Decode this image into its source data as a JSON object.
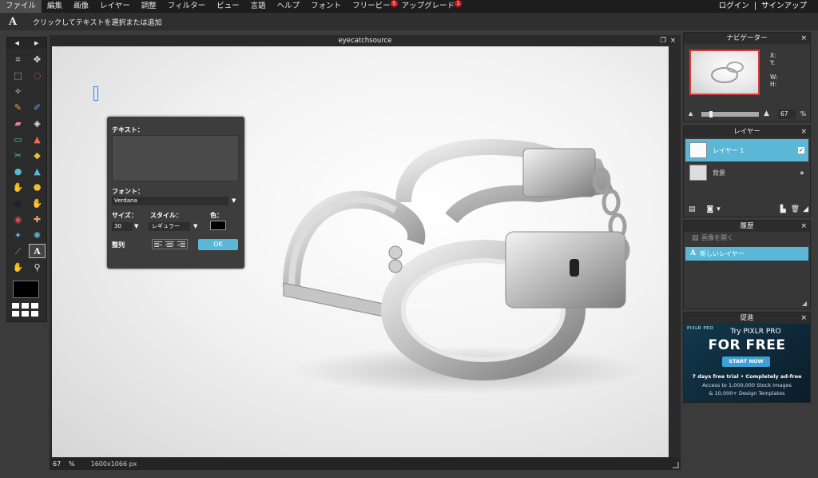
{
  "menu": {
    "items": [
      {
        "label": "ファイル"
      },
      {
        "label": "編集"
      },
      {
        "label": "画像"
      },
      {
        "label": "レイヤー"
      },
      {
        "label": "調整"
      },
      {
        "label": "フィルター"
      },
      {
        "label": "ビュー"
      },
      {
        "label": "言語"
      },
      {
        "label": "ヘルプ"
      },
      {
        "label": "フォント"
      },
      {
        "label": "フリービー",
        "badge": "5"
      },
      {
        "label": "アップグレード",
        "badge": "1"
      }
    ],
    "login": "ログイン",
    "separator": "|",
    "signup": "サインアップ"
  },
  "options_bar": {
    "tool_icon": "A",
    "hint": "クリックしてテキストを選択または追加"
  },
  "toolbox": {
    "nav_left": "◀",
    "nav_right": "▶",
    "tools": [
      {
        "name": "crop-tool-icon",
        "glyph": "⌗",
        "color": "#e8e8e8"
      },
      {
        "name": "move-tool-icon",
        "glyph": "✥",
        "color": "#e8e8e8"
      },
      {
        "name": "marquee-tool-icon",
        "glyph": "⬚",
        "color": "#e8e8e8"
      },
      {
        "name": "lasso-tool-icon",
        "glyph": "◌",
        "color": "#e85d5d"
      },
      {
        "name": "magic-wand-tool-icon",
        "glyph": "✧",
        "color": "#e8e8e8"
      },
      {
        "name": "blank-slot",
        "glyph": "",
        "color": "#e8e8e8"
      },
      {
        "name": "pencil-tool-icon",
        "glyph": "✎",
        "color": "#f0a030"
      },
      {
        "name": "brush-tool-icon",
        "glyph": "✐",
        "color": "#60a0f0"
      },
      {
        "name": "eraser-tool-icon",
        "glyph": "▰",
        "color": "#f07aa0"
      },
      {
        "name": "paint-bucket-tool-icon",
        "glyph": "◈",
        "color": "#e8e8e8"
      },
      {
        "name": "gradient-tool-icon",
        "glyph": "▭",
        "color": "#5ab8d6"
      },
      {
        "name": "clone-stamp-tool-icon",
        "glyph": "▲",
        "color": "#e07050"
      },
      {
        "name": "color-replace-tool-icon",
        "glyph": "✂",
        "color": "#5ab8d6"
      },
      {
        "name": "drawing-tool-icon",
        "glyph": "◆",
        "color": "#f0c030"
      },
      {
        "name": "blur-tool-icon",
        "glyph": "●",
        "color": "#5ab8d6"
      },
      {
        "name": "sharpen-tool-icon",
        "glyph": "▲",
        "color": "#5ab8d6"
      },
      {
        "name": "smudge-tool-icon",
        "glyph": "✋",
        "color": "#f0a030"
      },
      {
        "name": "sponge-tool-icon",
        "glyph": "⬣",
        "color": "#f0c030"
      },
      {
        "name": "dodge-tool-icon",
        "glyph": "●",
        "color": "#222222"
      },
      {
        "name": "burn-tool-icon",
        "glyph": "✋",
        "color": "#f0a030"
      },
      {
        "name": "red-eye-tool-icon",
        "glyph": "◉",
        "color": "#e05050"
      },
      {
        "name": "spot-heal-tool-icon",
        "glyph": "✚",
        "color": "#f0a070"
      },
      {
        "name": "bloat-tool-icon",
        "glyph": "✦",
        "color": "#5ab8d6"
      },
      {
        "name": "pinch-tool-icon",
        "glyph": "✺",
        "color": "#5ab8d6"
      },
      {
        "name": "color-picker-tool-icon",
        "glyph": "⟋",
        "color": "#5ab8d6"
      },
      {
        "name": "type-tool-icon",
        "glyph": "A",
        "color": "#ffffff",
        "selected": true
      },
      {
        "name": "hand-tool-icon",
        "glyph": "✋",
        "color": "#f0c090"
      },
      {
        "name": "zoom-tool-icon",
        "glyph": "⚲",
        "color": "#e8e8e8"
      }
    ]
  },
  "document": {
    "title": "eyecatchsource",
    "restore_icon": "❐",
    "close_icon": "×",
    "zoom": "67",
    "zoom_unit": "%",
    "dimensions": "1600x1066 px"
  },
  "text_dialog": {
    "text_label": "テキスト：",
    "text_value": "",
    "font_label": "フォント：",
    "font_value": "Verdana",
    "size_label": "サイズ：",
    "size_value": "30",
    "style_label": "スタイル：",
    "style_value": "レギュラー",
    "color_label": "色：",
    "color_value": "#000000",
    "align_label": "整列",
    "ok_label": "OK"
  },
  "navigator": {
    "title": "ナビゲーター",
    "x_label": "X:",
    "y_label": "Y:",
    "w_label": "W:",
    "h_label": "H:",
    "zoom_value": "67",
    "zoom_unit": "%",
    "slider_fraction": 0.15
  },
  "layers": {
    "title": "レイヤー",
    "items": [
      {
        "label": "レイヤー 1",
        "active": true
      },
      {
        "label": "背景",
        "locked": true
      }
    ]
  },
  "history": {
    "title": "履歴",
    "items": [
      {
        "label": "画像を開く"
      },
      {
        "label": "新しいレイヤー",
        "active": true
      }
    ]
  },
  "promo": {
    "title": "促進",
    "logo": "PIXLR PRO",
    "headline_small": "Try PIXLR PRO",
    "headline_big": "FOR FREE",
    "cta": "START NOW",
    "line1": "7 days free trial • Completely ad-free",
    "line2": "Access to 1,000,000 Stock Images",
    "line3": "& 10,000+ Design Templates"
  },
  "colors": {
    "accent": "#5ab8d6",
    "badge": "#d7191c",
    "foreground_color": "#000000"
  }
}
